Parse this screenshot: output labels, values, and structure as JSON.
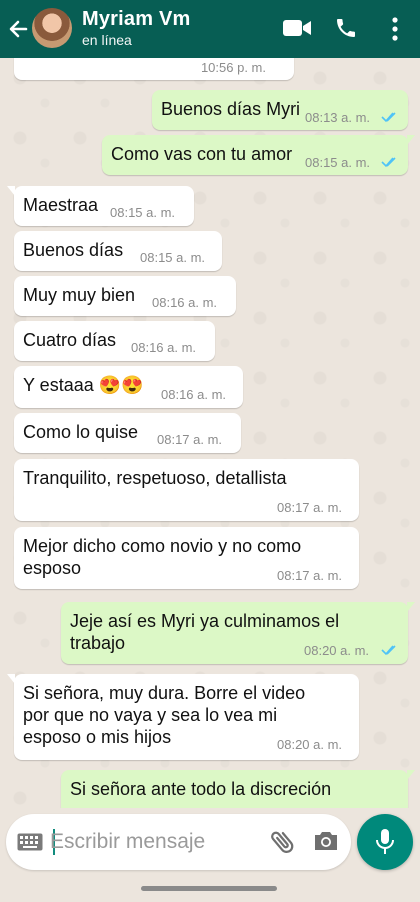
{
  "header": {
    "contact_name": "Myriam Vm",
    "status": "en línea",
    "color": "#075e54"
  },
  "messages": [
    {
      "direction": "in",
      "text": "",
      "time": "10:56 p. m."
    },
    {
      "direction": "out",
      "text": "Buenos días Myri",
      "time": "08:13 a. m.",
      "read": true
    },
    {
      "direction": "out",
      "text": "Como vas con tu amor",
      "time": "08:15 a. m.",
      "read": true
    },
    {
      "direction": "in",
      "text": "Maestraa",
      "time": "08:15 a. m."
    },
    {
      "direction": "in",
      "text": "Buenos días",
      "time": "08:15 a. m."
    },
    {
      "direction": "in",
      "text": "Muy muy bien",
      "time": "08:16 a. m."
    },
    {
      "direction": "in",
      "text": "Cuatro días",
      "time": "08:16 a. m."
    },
    {
      "direction": "in",
      "text": "Y estaaa 😍😍",
      "time": "08:16 a. m."
    },
    {
      "direction": "in",
      "text": "Como lo quise",
      "time": "08:17 a. m."
    },
    {
      "direction": "in",
      "text": "Tranquilito, respetuoso, detallista",
      "time": "08:17 a. m."
    },
    {
      "direction": "in",
      "text": "Mejor dicho como novio y no como\nesposo",
      "time": "08:17 a. m."
    },
    {
      "direction": "out",
      "text": "Jeje así es Myri ya culminamos el\ntrabajo",
      "time": "08:20 a. m.",
      "read": true
    },
    {
      "direction": "in",
      "text": "Si señora, muy dura. Borre el video\npor que no vaya y sea lo vea mi\nesposo o mis hijos",
      "time": "08:20 a. m."
    },
    {
      "direction": "out",
      "text": "Si señora ante todo la discreción",
      "time": ""
    }
  ],
  "composer": {
    "placeholder": "Escribir mensaje"
  },
  "icons": {
    "back": "back-arrow-icon",
    "video": "video-call-icon",
    "phone": "phone-icon",
    "menu": "more-vert-icon",
    "keyboard": "keyboard-icon",
    "attach": "attach-icon",
    "camera": "camera-icon",
    "mic": "mic-icon"
  },
  "colors": {
    "outgoing_bubble": "#dcf8c6",
    "incoming_bubble": "#ffffff",
    "read_ticks": "#4fc3f7",
    "mic_button": "#00897b"
  }
}
